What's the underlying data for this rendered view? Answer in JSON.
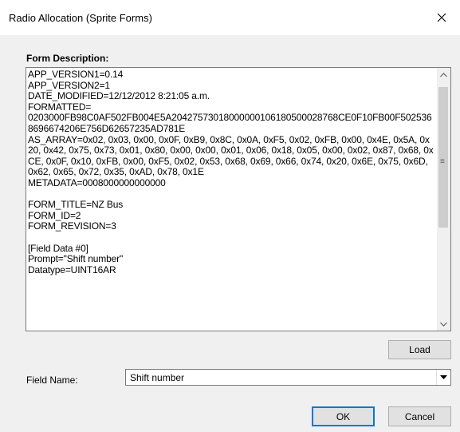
{
  "dialog": {
    "title": "Radio Allocation (Sprite Forms)"
  },
  "form_description": {
    "label": "Form Description:",
    "text": "APP_VERSION1=0.14\nAPP_VERSION2=1\nDATE_MODIFIED=12/12/2012 8:21:05 a.m.\nFORMATTED=\n0203000FB98C0AF502FB004E5A20427573018000000106180500028768CE0F10FB00F5025368696674206E756D62657235AD781E\nAS_ARRAY=0x02, 0x03, 0x00, 0x0F, 0xB9, 0x8C, 0x0A, 0xF5, 0x02, 0xFB, 0x00, 0x4E, 0x5A, 0x20, 0x42, 0x75, 0x73, 0x01, 0x80, 0x00, 0x00, 0x01, 0x06, 0x18, 0x05, 0x00, 0x02, 0x87, 0x68, 0xCE, 0x0F, 0x10, 0xFB, 0x00, 0xF5, 0x02, 0x53, 0x68, 0x69, 0x66, 0x74, 0x20, 0x6E, 0x75, 0x6D, 0x62, 0x65, 0x72, 0x35, 0xAD, 0x78, 0x1E\nMETADATA=0008000000000000\n\nFORM_TITLE=NZ Bus\nFORM_ID=2\nFORM_REVISION=3\n\n[Field Data #0]\nPrompt=\"Shift number\"\nDatatype=UINT16AR"
  },
  "buttons": {
    "load": "Load",
    "ok": "OK",
    "cancel": "Cancel"
  },
  "field_name": {
    "label": "Field Name:",
    "selected": "Shift number"
  },
  "icons": {
    "close": "close-icon",
    "scroll_up": "chevron-up-icon",
    "scroll_down": "chevron-down-icon",
    "dropdown": "chevron-down-icon"
  }
}
